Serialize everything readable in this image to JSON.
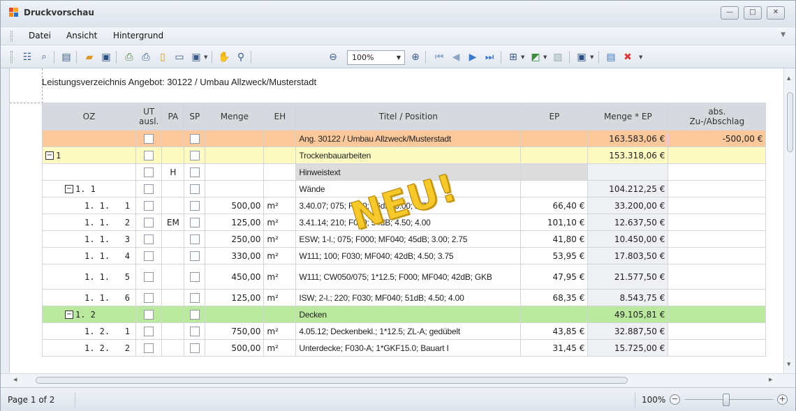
{
  "window": {
    "title": "Druckvorschau",
    "controls": {
      "minimize": "—",
      "maximize": "□",
      "close": "✕"
    }
  },
  "menu": {
    "items": [
      "Datei",
      "Ansicht",
      "Hintergrund"
    ]
  },
  "toolbar": {
    "zoom_value": "100%",
    "icons": [
      "document-map-icon",
      "find-icon",
      "customize-icon",
      "open-icon",
      "save-icon",
      "print-dialog-icon",
      "print-icon",
      "page-setup-icon",
      "header-footer-icon",
      "scale-icon",
      "hand-tool-icon",
      "magnifier-icon",
      "zoom-out-icon",
      "zoom-in-icon",
      "first-page-icon",
      "previous-page-icon",
      "next-page-icon",
      "last-page-icon",
      "multiple-pages-icon",
      "fill-background-icon",
      "watermark-icon",
      "export-icon",
      "send-icon",
      "close-preview-icon"
    ]
  },
  "document": {
    "heading": "Leistungsverzeichnis Angebot: 30122 / Umbau Allzweck/Musterstadt",
    "stamp": "NEU!",
    "columns": [
      "OZ",
      "UT ausl.",
      "PA",
      "SP",
      "Menge",
      "EH",
      "Titel / Position",
      "EP",
      "Menge * EP",
      "abs. Zu-/Abschlag"
    ],
    "rows": [
      {
        "kind": "ang",
        "oz": "",
        "level": 0,
        "toggle": false,
        "ut": true,
        "pa": "",
        "sp": true,
        "menge": "",
        "eh": "",
        "titel": "Ang. 30122 / Umbau Allzweck/Musterstadt",
        "ep": "",
        "mengeep": "163.583,06 €",
        "abs": "-500,00 €"
      },
      {
        "kind": "title1",
        "oz": "1",
        "level": 0,
        "toggle": true,
        "ut": true,
        "pa": "",
        "sp": true,
        "menge": "",
        "eh": "",
        "titel": "Trockenbauarbeiten",
        "ep": "",
        "mengeep": "153.318,06 €",
        "abs": ""
      },
      {
        "kind": "note",
        "oz": "",
        "level": 1,
        "toggle": false,
        "ut": true,
        "pa": "H",
        "sp": true,
        "menge": "",
        "eh": "",
        "titel": "Hinweistext",
        "ep": "",
        "mengeep": "",
        "abs": ""
      },
      {
        "kind": "title2",
        "oz": "1. 1",
        "level": 1,
        "toggle": true,
        "ut": true,
        "pa": "",
        "sp": true,
        "menge": "",
        "eh": "",
        "titel": "Wände",
        "ep": "",
        "mengeep": "104.212,25 €",
        "abs": ""
      },
      {
        "kind": "pos",
        "oz": "1. 1.   1",
        "level": 2,
        "toggle": false,
        "ut": true,
        "pa": "",
        "sp": true,
        "menge": "500,00",
        "eh": "m²",
        "titel": "3.40.07; 075; F030; 46dB; 3.00; 2.75",
        "ep": "66,40 €",
        "mengeep": "33.200,00 €",
        "abs": ""
      },
      {
        "kind": "pos",
        "oz": "1. 1.   2",
        "level": 2,
        "toggle": false,
        "ut": true,
        "pa": "EM",
        "sp": true,
        "menge": "125,00",
        "eh": "m²",
        "titel": "3.41.14; 210; F030; 54dB; 4.50; 4.00",
        "ep": "101,10 €",
        "mengeep": "12.637,50 €",
        "abs": ""
      },
      {
        "kind": "pos",
        "oz": "1. 1.   3",
        "level": 2,
        "toggle": false,
        "ut": true,
        "pa": "",
        "sp": true,
        "menge": "250,00",
        "eh": "m²",
        "titel": "ESW; 1-l.; 075; F000; MF040; 45dB; 3.00; 2.75",
        "ep": "41,80 €",
        "mengeep": "10.450,00 €",
        "abs": ""
      },
      {
        "kind": "pos",
        "oz": "1. 1.   4",
        "level": 2,
        "toggle": false,
        "ut": true,
        "pa": "",
        "sp": true,
        "menge": "330,00",
        "eh": "m²",
        "titel": "W111; 100; F030; MF040; 42dB; 4.50; 3.75",
        "ep": "53,95 €",
        "mengeep": "17.803,50 €",
        "abs": ""
      },
      {
        "kind": "pos2",
        "oz": "1. 1.   5",
        "level": 2,
        "toggle": false,
        "ut": true,
        "pa": "",
        "sp": true,
        "menge": "450,00",
        "eh": "m²",
        "titel": "W111; CW050/075; 1*12.5; F000; MF040; 42dB; GKB",
        "ep": "47,95 €",
        "mengeep": "21.577,50 €",
        "abs": ""
      },
      {
        "kind": "pos",
        "oz": "1. 1.   6",
        "level": 2,
        "toggle": false,
        "ut": true,
        "pa": "",
        "sp": true,
        "menge": "125,00",
        "eh": "m²",
        "titel": "ISW; 2-l.; 220; F030; MF040; 51dB; 4.50; 4.00",
        "ep": "68,35 €",
        "mengeep": "8.543,75 €",
        "abs": ""
      },
      {
        "kind": "title3",
        "oz": "1. 2",
        "level": 1,
        "toggle": true,
        "ut": true,
        "pa": "",
        "sp": true,
        "menge": "",
        "eh": "",
        "titel": "Decken",
        "ep": "",
        "mengeep": "49.105,81 €",
        "abs": ""
      },
      {
        "kind": "pos",
        "oz": "1. 2.   1",
        "level": 2,
        "toggle": false,
        "ut": true,
        "pa": "",
        "sp": true,
        "menge": "750,00",
        "eh": "m²",
        "titel": "4.05.12; Deckenbekl.; 1*12.5; ZL-A; gedübelt",
        "ep": "43,85 €",
        "mengeep": "32.887,50 €",
        "abs": ""
      },
      {
        "kind": "pos",
        "oz": "1. 2.   2",
        "level": 2,
        "toggle": false,
        "ut": true,
        "pa": "",
        "sp": true,
        "menge": "500,00",
        "eh": "m²",
        "titel": "Unterdecke; F030-A; 1*GKF15.0; Bauart I",
        "ep": "31,45 €",
        "mengeep": "15.725,00 €",
        "abs": ""
      }
    ]
  },
  "status": {
    "page": "Page 1 of 2",
    "zoom": "100%",
    "zoom_level": 0.47
  },
  "colors": {
    "angebot_row": "#fbc89b",
    "title_row": "#fdfbc2",
    "subtitle_row": "#b9e89e",
    "stamp": "#f7c82a"
  }
}
